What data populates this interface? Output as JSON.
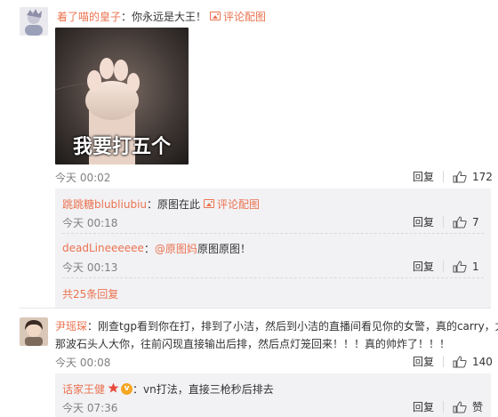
{
  "comments": [
    {
      "username": "着了喵的皇子",
      "text": "：你永远是大王！",
      "view_image": "评论配图",
      "image_caption": "我要打五个",
      "time": "今天 00:02",
      "reply_label": "回复",
      "likes": "172",
      "replies": [
        {
          "username": "跳跳糖blubliubiu",
          "text": "：原图在此",
          "view_image": "评论配图",
          "time": "今天 00:18",
          "reply_label": "回复",
          "likes": "7"
        },
        {
          "username": "deadLineeeeee",
          "text_sep": "：",
          "mention": "@原图妈",
          "text": " 原图原图！",
          "time": "今天 00:13",
          "reply_label": "回复",
          "likes": "1"
        }
      ],
      "total_replies": "共25条回复"
    },
    {
      "username": "尹瑶琛",
      "text_line1": "：刚查tgp看到你在打，排到了小洁，然后到小洁的直播间看见你的女警，真的carry，尤其",
      "text_line2": "那波石头人大你，往前闪现直接输出后排，然后点灯笼回来！！！真的帅炸了！！！",
      "time": "今天 00:08",
      "reply_label": "回复",
      "likes": "140",
      "replies": [
        {
          "username": "话家王健",
          "vip_badge": "v",
          "text": "：vn打法，直接三枪秒后排去",
          "time": "今天 07:36",
          "reply_label": "回复",
          "likes": "赞"
        }
      ]
    }
  ],
  "colors": {
    "link": "#eb7350",
    "meta": "#808080",
    "reply_bg": "#f2f2f5",
    "crown": "#e84c3d"
  }
}
